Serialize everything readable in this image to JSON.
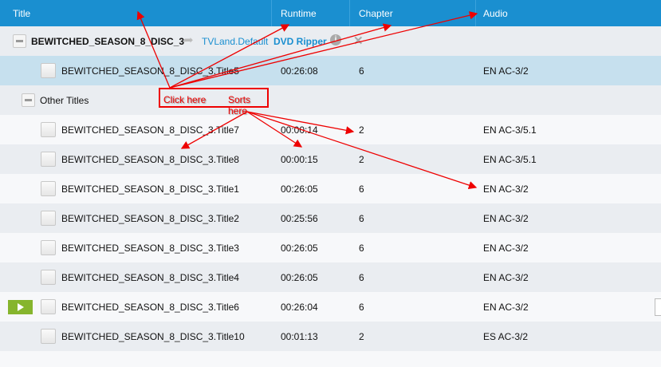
{
  "columns": {
    "title": "Title",
    "runtime": "Runtime",
    "chapter": "Chapter",
    "audio": "Audio"
  },
  "disc": {
    "name": "BEWITCHED_SEASON_8_DISC_3",
    "profile": "TVLand.Default",
    "ripper": "DVD Ripper"
  },
  "selected_row": {
    "title": "BEWITCHED_SEASON_8_DISC_3.Title5",
    "runtime": "00:26:08",
    "chapter": "6",
    "audio": "EN AC-3/2"
  },
  "other_titles_label": "Other Titles",
  "rows": [
    {
      "title": "BEWITCHED_SEASON_8_DISC_3.Title7",
      "runtime": "00:00:14",
      "chapter": "2",
      "audio": "EN AC-3/5.1"
    },
    {
      "title": "BEWITCHED_SEASON_8_DISC_3.Title8",
      "runtime": "00:00:15",
      "chapter": "2",
      "audio": "EN AC-3/5.1"
    },
    {
      "title": "BEWITCHED_SEASON_8_DISC_3.Title1",
      "runtime": "00:26:05",
      "chapter": "6",
      "audio": "EN AC-3/2"
    },
    {
      "title": "BEWITCHED_SEASON_8_DISC_3.Title2",
      "runtime": "00:25:56",
      "chapter": "6",
      "audio": "EN AC-3/2"
    },
    {
      "title": "BEWITCHED_SEASON_8_DISC_3.Title3",
      "runtime": "00:26:05",
      "chapter": "6",
      "audio": "EN AC-3/2"
    },
    {
      "title": "BEWITCHED_SEASON_8_DISC_3.Title4",
      "runtime": "00:26:05",
      "chapter": "6",
      "audio": "EN AC-3/2"
    },
    {
      "title": "BEWITCHED_SEASON_8_DISC_3.Title6",
      "runtime": "00:26:04",
      "chapter": "6",
      "audio": "EN AC-3/2",
      "playing": true
    },
    {
      "title": "BEWITCHED_SEASON_8_DISC_3.Title10",
      "runtime": "00:01:13",
      "chapter": "2",
      "audio": "ES AC-3/2"
    }
  ],
  "annotation": {
    "click": "Click here",
    "sorts": "Sorts here"
  },
  "colors": {
    "header": "#1a8fd0",
    "selected": "#c6e0ee",
    "play": "#86b52d",
    "annotation": "#ee0000"
  }
}
